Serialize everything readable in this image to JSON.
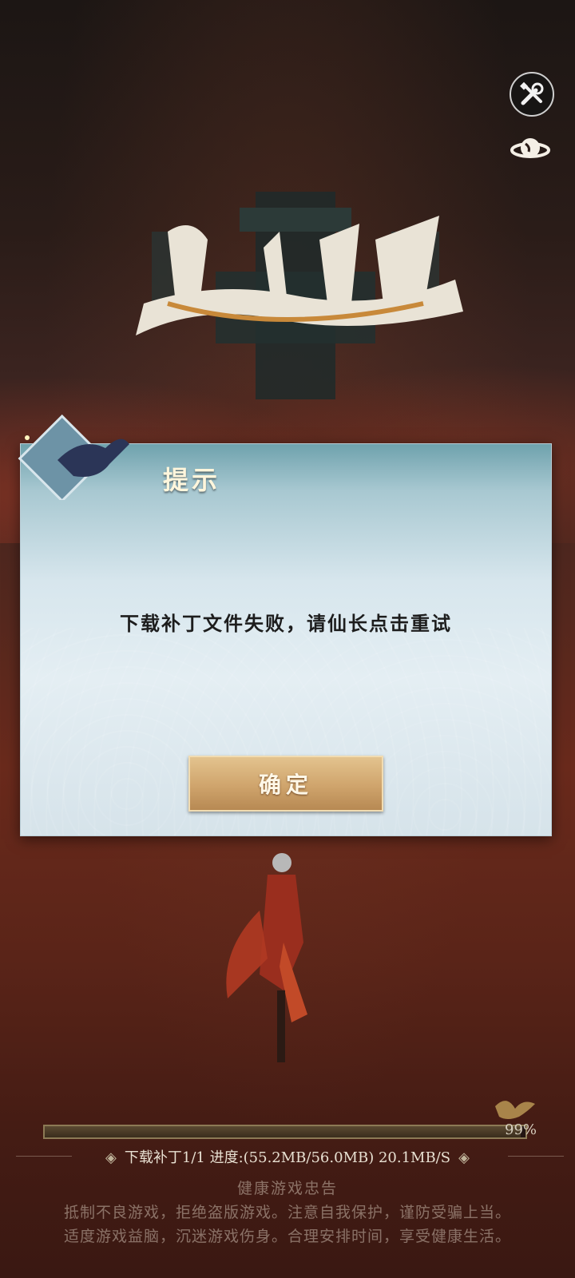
{
  "dialog": {
    "title": "提示",
    "message": "下载补丁文件失败，请仙长点击重试",
    "confirm_label": "确定"
  },
  "top_icons": {
    "tools": "tools-icon",
    "planet": "planet-icon"
  },
  "progress": {
    "value": 0.99,
    "percent_label": "99%"
  },
  "download": {
    "text": "下载补丁1/1 进度:(55.2MB/56.0MB)  20.1MB/S"
  },
  "health_notice": {
    "title": "健康游戏忠告",
    "line1": "抵制不良游戏，拒绝盗版游戏。注意自我保护，谨防受骗上当。",
    "line2": "适度游戏益脑，沉迷游戏伤身。合理安排时间，享受健康生活。"
  },
  "colors": {
    "accent_gold": "#cfa46c",
    "dialog_top": "#6fa2ad"
  }
}
